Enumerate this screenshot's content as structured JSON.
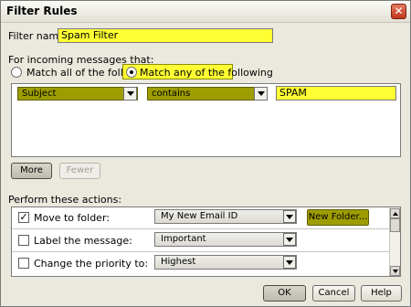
{
  "window": {
    "title": "Filter Rules",
    "close_glyph": "✕"
  },
  "filter_name": {
    "label": "Filter name:",
    "value": "Spam Filter"
  },
  "incoming": {
    "label": "For incoming messages that:",
    "options": [
      {
        "label": "Match all of the following",
        "selected": false
      },
      {
        "label": "Match any of the following",
        "selected": true
      }
    ]
  },
  "rule": {
    "field": "Subject",
    "operator": "contains",
    "value": "SPAM"
  },
  "rule_buttons": {
    "more": "More",
    "fewer": "Fewer"
  },
  "actions": {
    "label": "Perform these actions:",
    "rows": [
      {
        "label": "Move to folder:",
        "checked": true,
        "value": "My New Email ID",
        "extra_button": "New Folder..."
      },
      {
        "label": "Label the message:",
        "checked": false,
        "value": "Important"
      },
      {
        "label": "Change the priority to:",
        "checked": false,
        "value": "Highest"
      }
    ]
  },
  "footer": {
    "ok": "OK",
    "cancel": "Cancel",
    "help": "Help"
  },
  "icons": {
    "close": "close-icon",
    "dropdown": "chevron-down-icon",
    "check": "checkmark-icon"
  },
  "colors": {
    "highlight": "#ffff33",
    "accent_olive": "#9d9d00",
    "dialog_bg": "#ebe9de"
  }
}
